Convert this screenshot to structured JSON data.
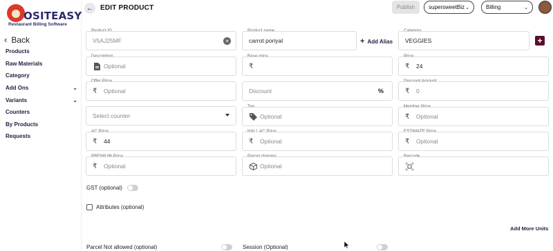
{
  "brand": {
    "name": "OSITEASY",
    "tagline": "Restaurant Billing Software"
  },
  "sidebar": {
    "back_label": "Back",
    "items": [
      {
        "label": "Products",
        "has_chevron": false
      },
      {
        "label": "Raw Materials",
        "has_chevron": false
      },
      {
        "label": "Category",
        "has_chevron": false
      },
      {
        "label": "Add Ons",
        "has_chevron": true
      },
      {
        "label": "Variants",
        "has_chevron": true
      },
      {
        "label": "Counters",
        "has_chevron": false
      },
      {
        "label": "By Products",
        "has_chevron": false
      },
      {
        "label": "Requests",
        "has_chevron": false
      }
    ]
  },
  "header": {
    "title": "EDIT PRODUCT",
    "publish_label": "Publish",
    "business_select": "supersweetBiz",
    "mode_select": "Billing"
  },
  "form": {
    "product_id": {
      "label": "Product ID",
      "value": "V5AJ25MF"
    },
    "product_name": {
      "label": "Product name",
      "value": "carrot poriyal",
      "add_alias_label": "Add Alias"
    },
    "category": {
      "label": "Category",
      "value": "VEGGIES"
    },
    "description": {
      "label": "Description",
      "placeholder": "Optional"
    },
    "base_price": {
      "label": "Base price",
      "value": ""
    },
    "price": {
      "label": "Price",
      "value": "24"
    },
    "offer_price": {
      "label": "Offer Price",
      "placeholder": "Optional"
    },
    "discount": {
      "placeholder": "Discount",
      "suffix": "%"
    },
    "discount_amount": {
      "label": "Discount Amount",
      "placeholder": "0"
    },
    "counter": {
      "placeholder": "Select counter"
    },
    "tag": {
      "label": "Tag",
      "placeholder": "Optional"
    },
    "member_price": {
      "label": "Member Price",
      "placeholder": "Optional"
    },
    "ac_price": {
      "label": "AC Price",
      "value": "44"
    },
    "hall_ac_price": {
      "label": "HALL AC Price",
      "placeholder": "Optional"
    },
    "estimate_price": {
      "label": "ESTIMATE Price",
      "placeholder": "Optional"
    },
    "premium_price": {
      "label": "PREMIUM Price",
      "placeholder": "Optional"
    },
    "parcel_charges": {
      "label": "Parcel charges",
      "placeholder": "Optional"
    },
    "barcode": {
      "label": "Barcode"
    },
    "gst_label": "GST (optional)",
    "attributes_label": "Attributes (optional)",
    "add_more_units_label": "Add More Units",
    "parcel_not_allowed_label": "Parcel Not allowed (optional)",
    "session_label": "Session (Optional)",
    "currency_symbol": "₹"
  },
  "colors": {
    "accent": "#5a0e2d",
    "nav_text": "#1e1e3f"
  }
}
